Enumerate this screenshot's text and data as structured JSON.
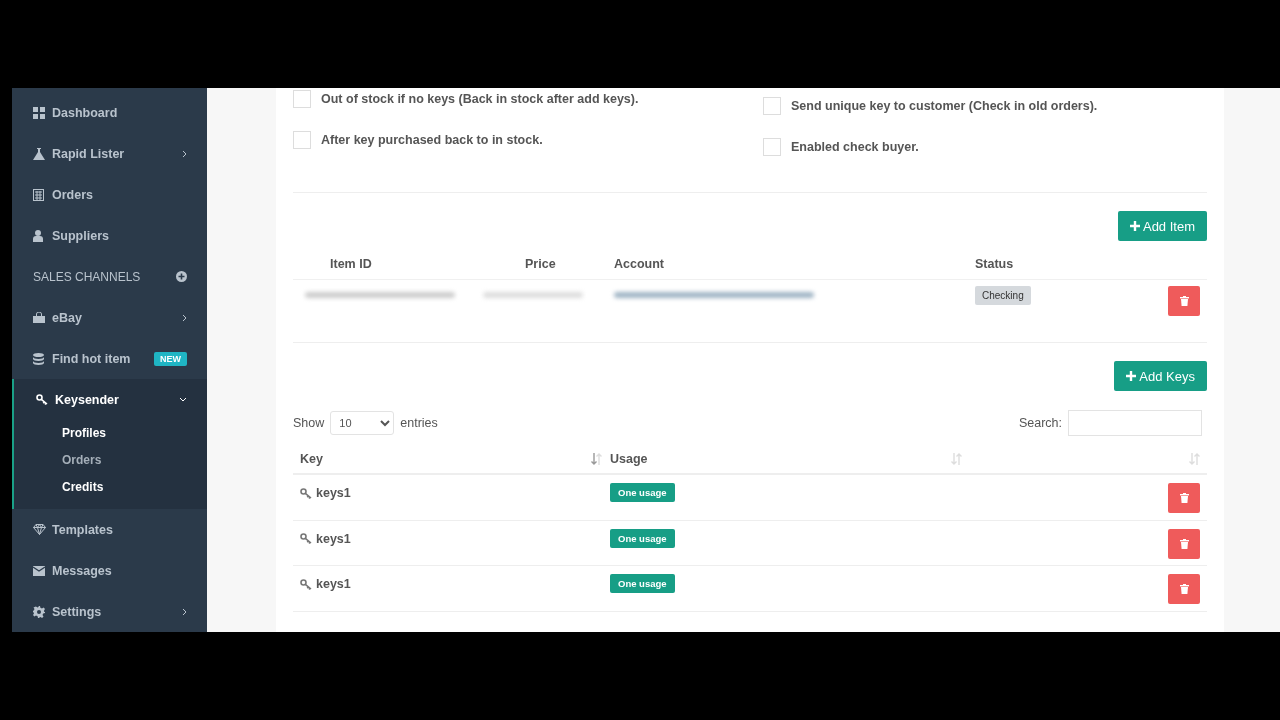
{
  "sidebar": {
    "items": [
      {
        "kind": "link",
        "label": "Dashboard",
        "submenu": false
      },
      {
        "kind": "link",
        "label": "Rapid Lister",
        "submenu": true
      },
      {
        "kind": "link",
        "label": "Orders",
        "submenu": false
      },
      {
        "kind": "link",
        "label": "Suppliers",
        "submenu": false
      },
      {
        "kind": "section",
        "label": "SALES CHANNELS"
      },
      {
        "kind": "link",
        "label": "eBay",
        "submenu": true
      },
      {
        "kind": "link",
        "label": "Find hot item",
        "submenu": false,
        "badge": "NEW"
      },
      {
        "kind": "link",
        "label": "Keysender",
        "submenu": true,
        "expanded": true,
        "children": [
          {
            "label": "Profiles",
            "selected": true
          },
          {
            "label": "Orders",
            "selected": false
          },
          {
            "label": "Credits",
            "selected": true
          }
        ]
      },
      {
        "kind": "link",
        "label": "Templates",
        "submenu": false
      },
      {
        "kind": "link",
        "label": "Messages",
        "submenu": false
      },
      {
        "kind": "link",
        "label": "Settings",
        "submenu": true
      }
    ]
  },
  "options": [
    {
      "label": "Out of stock if no keys (Back in stock after add keys).",
      "checked": false
    },
    {
      "label": "Send unique key to customer (Check in old orders).",
      "checked": false
    },
    {
      "label": "After key purchased back to in stock.",
      "checked": false
    },
    {
      "label": "Enabled check buyer.",
      "checked": false
    }
  ],
  "items": {
    "button": "Add Item",
    "columns": [
      "Item ID",
      "Price",
      "Account",
      "Status"
    ],
    "rows": [
      {
        "status": "Checking"
      }
    ]
  },
  "keys": {
    "button": "Add Keys",
    "show_label": "Show",
    "page_size": "10",
    "entries_label": "entries",
    "search_label": "Search:",
    "columns": [
      {
        "label": "Key",
        "sorted": true
      },
      {
        "label": "Usage",
        "sorted": false
      },
      {
        "sorted": false
      }
    ],
    "rows": [
      {
        "key": "keys1",
        "usage": "One usage"
      },
      {
        "key": "keys1",
        "usage": "One usage"
      },
      {
        "key": "keys1",
        "usage": "One usage"
      }
    ]
  }
}
